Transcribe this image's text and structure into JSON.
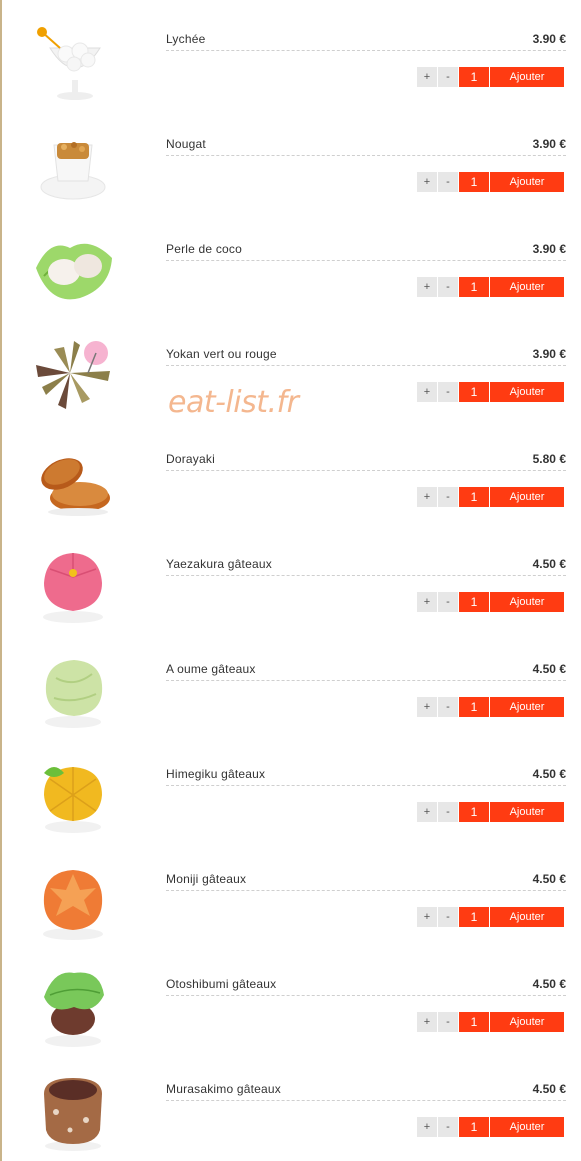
{
  "items": [
    {
      "name": "Lychée",
      "price": "3.90 €",
      "qty": "1",
      "image_icon": "lychee-dessert-icon"
    },
    {
      "name": "Nougat",
      "price": "3.90 €",
      "qty": "1",
      "image_icon": "nougat-dessert-icon"
    },
    {
      "name": "Perle de coco",
      "price": "3.90 €",
      "qty": "1",
      "image_icon": "coconut-pearl-icon"
    },
    {
      "name": "Yokan vert ou rouge",
      "price": "3.90 €",
      "qty": "1",
      "image_icon": "yokan-icon"
    },
    {
      "name": "Dorayaki",
      "price": "5.80 €",
      "qty": "1",
      "image_icon": "dorayaki-icon"
    },
    {
      "name": "Yaezakura gâteaux",
      "price": "4.50 €",
      "qty": "1",
      "image_icon": "wagashi-pink-icon"
    },
    {
      "name": "A oume gâteaux",
      "price": "4.50 €",
      "qty": "1",
      "image_icon": "wagashi-green-icon"
    },
    {
      "name": "Himegiku gâteaux",
      "price": "4.50 €",
      "qty": "1",
      "image_icon": "wagashi-yellow-icon"
    },
    {
      "name": "Moniji gâteaux",
      "price": "4.50 €",
      "qty": "1",
      "image_icon": "wagashi-orange-icon"
    },
    {
      "name": "Otoshibumi gâteaux",
      "price": "4.50 €",
      "qty": "1",
      "image_icon": "wagashi-leaf-icon"
    },
    {
      "name": "Murasakimo gâteaux",
      "price": "4.50 €",
      "qty": "1",
      "image_icon": "wagashi-brown-icon"
    }
  ],
  "controls": {
    "plus": "+",
    "minus": "-",
    "add": "Ajouter"
  },
  "watermark": "eat-list.fr",
  "colors": {
    "accent": "#ff3b12",
    "button_grey": "#e7e7e7",
    "text": "#333333",
    "watermark": "#f4b78f"
  }
}
